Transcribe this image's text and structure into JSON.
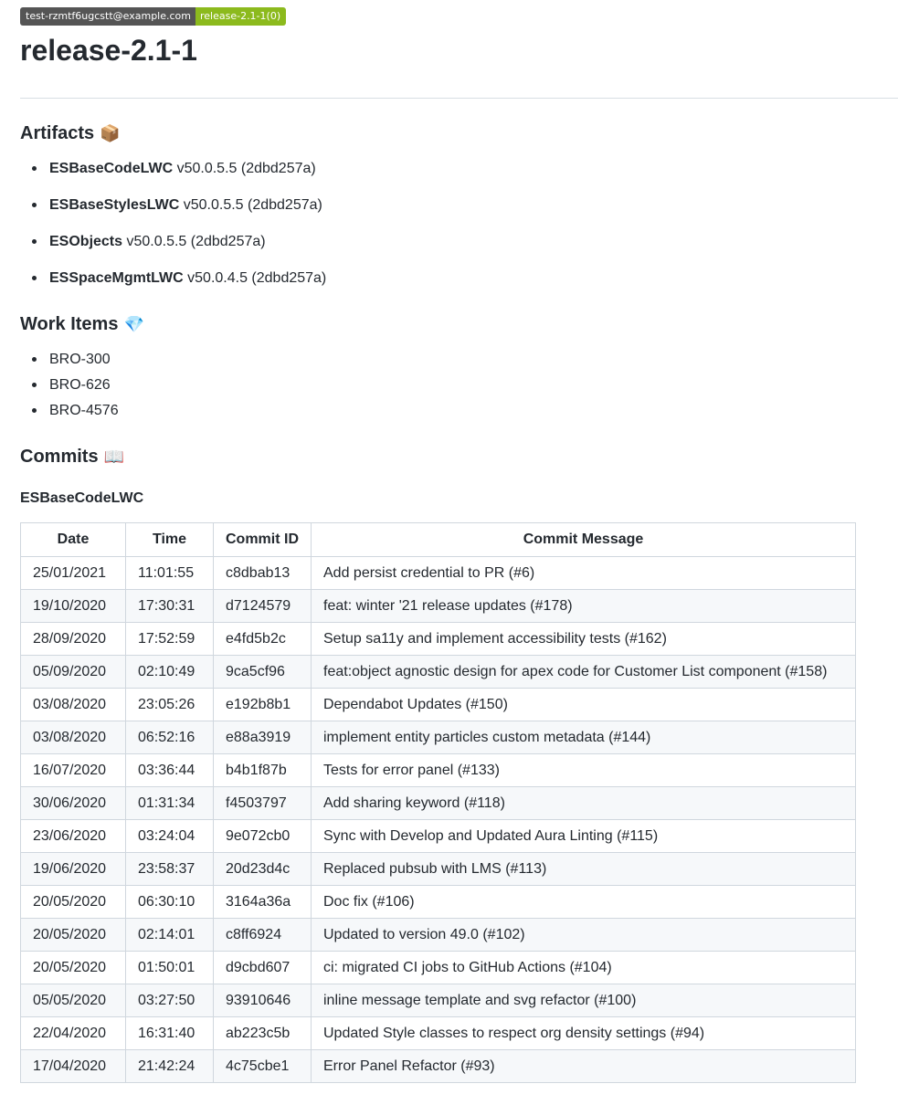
{
  "badges": {
    "user": "test-rzmtf6ugcstt@example.com",
    "release": "release-2.1-1(0)",
    "colors": {
      "left": "#555555",
      "right": "#8cba1d"
    }
  },
  "title": "release-2.1-1",
  "artifacts": {
    "heading": "Artifacts",
    "emoji": "📦",
    "items": [
      {
        "name": "ESBaseCodeLWC",
        "version": "v50.0.5.5 (2dbd257a)"
      },
      {
        "name": "ESBaseStylesLWC",
        "version": "v50.0.5.5 (2dbd257a)"
      },
      {
        "name": "ESObjects",
        "version": "v50.0.5.5 (2dbd257a)"
      },
      {
        "name": "ESSpaceMgmtLWC",
        "version": "v50.0.4.5 (2dbd257a)"
      }
    ]
  },
  "work_items": {
    "heading": "Work Items",
    "emoji": "💎",
    "items": [
      "BRO-300",
      "BRO-626",
      "BRO-4576"
    ]
  },
  "commits": {
    "heading": "Commits",
    "emoji": "📖",
    "group_title": "ESBaseCodeLWC",
    "columns": [
      "Date",
      "Time",
      "Commit ID",
      "Commit Message"
    ],
    "rows": [
      [
        "25/01/2021",
        "11:01:55",
        "c8dbab13",
        "Add persist credential to PR (#6)"
      ],
      [
        "19/10/2020",
        "17:30:31",
        "d7124579",
        "feat: winter '21 release updates (#178)"
      ],
      [
        "28/09/2020",
        "17:52:59",
        "e4fd5b2c",
        "Setup sa11y and implement accessibility tests (#162)"
      ],
      [
        "05/09/2020",
        "02:10:49",
        "9ca5cf96",
        "feat:object agnostic design for apex code for Customer List component (#158)"
      ],
      [
        "03/08/2020",
        "23:05:26",
        "e192b8b1",
        "Dependabot Updates (#150)"
      ],
      [
        "03/08/2020",
        "06:52:16",
        "e88a3919",
        "implement entity particles custom metadata (#144)"
      ],
      [
        "16/07/2020",
        "03:36:44",
        "b4b1f87b",
        "Tests for error panel (#133)"
      ],
      [
        "30/06/2020",
        "01:31:34",
        "f4503797",
        "Add sharing keyword (#118)"
      ],
      [
        "23/06/2020",
        "03:24:04",
        "9e072cb0",
        "Sync with Develop and Updated Aura Linting (#115)"
      ],
      [
        "19/06/2020",
        "23:58:37",
        "20d23d4c",
        "Replaced pubsub with LMS (#113)"
      ],
      [
        "20/05/2020",
        "06:30:10",
        "3164a36a",
        "Doc fix (#106)"
      ],
      [
        "20/05/2020",
        "02:14:01",
        "c8ff6924",
        "Updated to version 49.0 (#102)"
      ],
      [
        "20/05/2020",
        "01:50:01",
        "d9cbd607",
        "ci: migrated CI jobs to GitHub Actions (#104)"
      ],
      [
        "05/05/2020",
        "03:27:50",
        "93910646",
        "inline message template and svg refactor (#100)"
      ],
      [
        "22/04/2020",
        "16:31:40",
        "ab223c5b",
        "Updated Style classes to respect org density settings (#94)"
      ],
      [
        "17/04/2020",
        "21:42:24",
        "4c75cbe1",
        "Error Panel Refactor (#93)"
      ]
    ]
  }
}
